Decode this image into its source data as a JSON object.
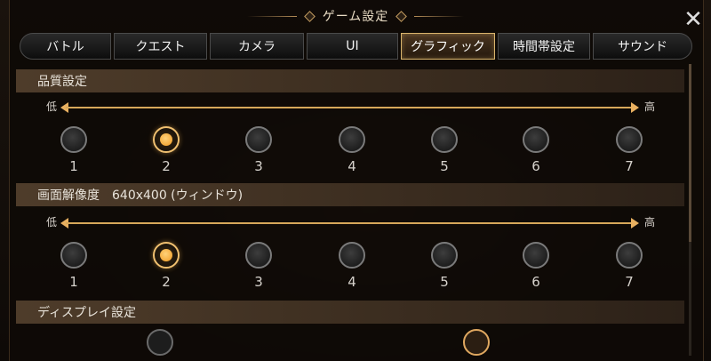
{
  "window": {
    "title": "ゲーム設定"
  },
  "tabs": [
    {
      "label": "バトル",
      "active": false
    },
    {
      "label": "クエスト",
      "active": false
    },
    {
      "label": "カメラ",
      "active": false
    },
    {
      "label": "UI",
      "active": false
    },
    {
      "label": "グラフィック",
      "active": true
    },
    {
      "label": "時間帯設定",
      "active": false
    },
    {
      "label": "サウンド",
      "active": false
    }
  ],
  "sections": [
    {
      "title": "品質設定",
      "low": "低",
      "high": "高",
      "options": [
        "1",
        "2",
        "3",
        "4",
        "5",
        "6",
        "7"
      ],
      "selected": "2"
    },
    {
      "title": "画面解像度　640x400 (ウィンドウ)",
      "low": "低",
      "high": "高",
      "options": [
        "1",
        "2",
        "3",
        "4",
        "5",
        "6",
        "7"
      ],
      "selected": "2"
    },
    {
      "title": "ディスプレイ設定"
    }
  ],
  "icons": {
    "close": "close-icon"
  },
  "colors": {
    "accent": "#d9b46c",
    "selected_dot": "#f5a833"
  }
}
